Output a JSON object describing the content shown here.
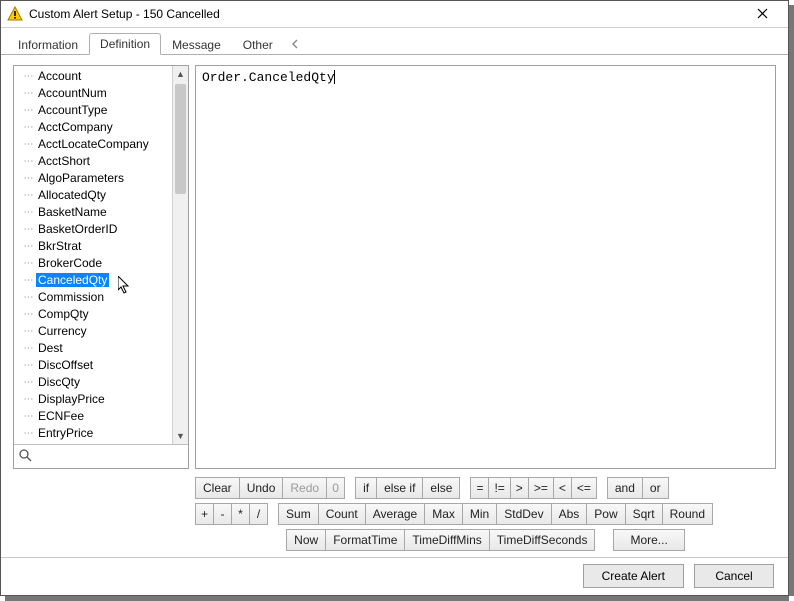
{
  "window": {
    "title": "Custom Alert Setup - 150 Cancelled"
  },
  "tabs": {
    "items": [
      "Information",
      "Definition",
      "Message",
      "Other"
    ],
    "active": 1
  },
  "tree": {
    "items": [
      "Account",
      "AccountNum",
      "AccountType",
      "AcctCompany",
      "AcctLocateCompany",
      "AcctShort",
      "AlgoParameters",
      "AllocatedQty",
      "BasketName",
      "BasketOrderID",
      "BkrStrat",
      "BrokerCode",
      "CanceledQty",
      "Commission",
      "CompQty",
      "Currency",
      "Dest",
      "DiscOffset",
      "DiscQty",
      "DisplayPrice",
      "ECNFee",
      "EntryPrice"
    ],
    "selected": "CanceledQty"
  },
  "search": {
    "placeholder": ""
  },
  "editor": {
    "text": "Order.CanceledQty"
  },
  "buttons": {
    "row1": {
      "clear": "Clear",
      "undo": "Undo",
      "redo": "Redo",
      "redo_count": "0",
      "if": "if",
      "elseif": "else if",
      "else": "else",
      "eq": "=",
      "neq": "!=",
      "gt": ">",
      "gte": ">=",
      "lt": "<",
      "lte": "<=",
      "and": "and",
      "or": "or"
    },
    "row2": {
      "plus": "+",
      "minus": "-",
      "mul": "*",
      "div": "/",
      "sum": "Sum",
      "count": "Count",
      "avg": "Average",
      "max": "Max",
      "min": "Min",
      "stddev": "StdDev",
      "abs": "Abs",
      "pow": "Pow",
      "sqrt": "Sqrt",
      "round": "Round"
    },
    "row3": {
      "now": "Now",
      "formattime": "FormatTime",
      "timedm": "TimeDiffMins",
      "timeds": "TimeDiffSeconds",
      "more": "More..."
    }
  },
  "footer": {
    "create": "Create Alert",
    "cancel": "Cancel"
  }
}
